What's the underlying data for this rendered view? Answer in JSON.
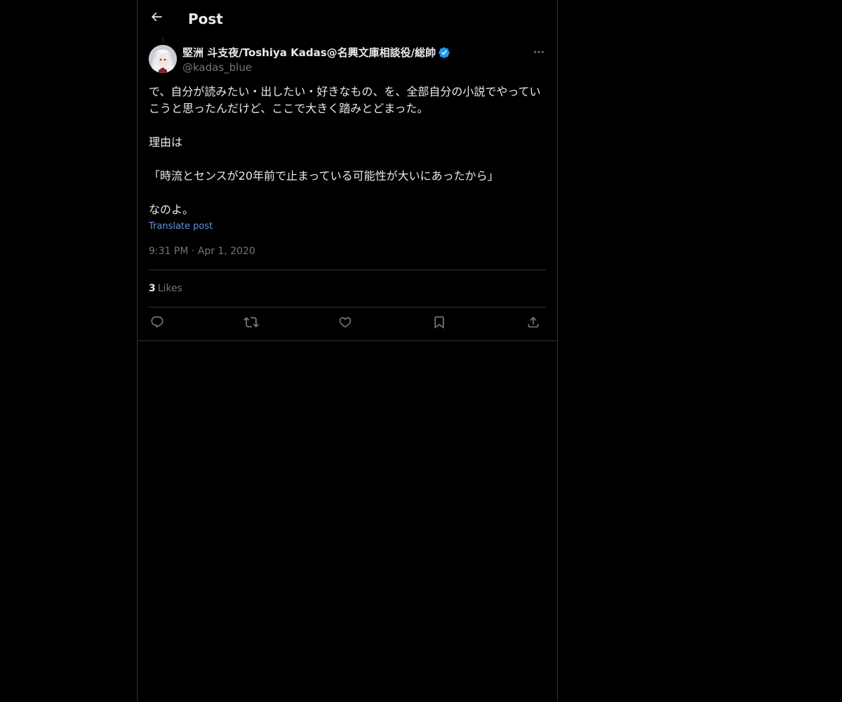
{
  "header": {
    "title": "Post",
    "back_icon": "arrow-left-icon"
  },
  "post": {
    "author": {
      "display_name": "堅洲 斗支夜/Toshiya Kadas@名興文庫相談役/総帥",
      "handle": "@kadas_blue",
      "verified": true,
      "verified_icon": "verified-badge-icon",
      "verified_color": "#1d9bf0"
    },
    "text": "で、自分が読みたい・出したい・好きなもの、を、全部自分の小説でやっていこうと思ったんだけど、ここで大きく踏みとどまった。\n\n理由は\n\n「時流とセンスが20年前で止まっている可能性が大いにあったから」\n\nなのよ。",
    "translate_label": "Translate post",
    "timestamp": "9:31 PM · Apr 1, 2020",
    "likes": {
      "count": "3",
      "label": "Likes"
    }
  },
  "actions": [
    {
      "name": "reply",
      "icon": "reply-icon"
    },
    {
      "name": "repost",
      "icon": "repost-icon"
    },
    {
      "name": "like",
      "icon": "heart-icon"
    },
    {
      "name": "bookmark",
      "icon": "bookmark-icon"
    },
    {
      "name": "share",
      "icon": "share-icon"
    }
  ],
  "colors": {
    "background": "#000000",
    "text_primary": "#e7e9ea",
    "text_secondary": "#71767b",
    "link": "#6494dd",
    "border": "#2f3336"
  }
}
